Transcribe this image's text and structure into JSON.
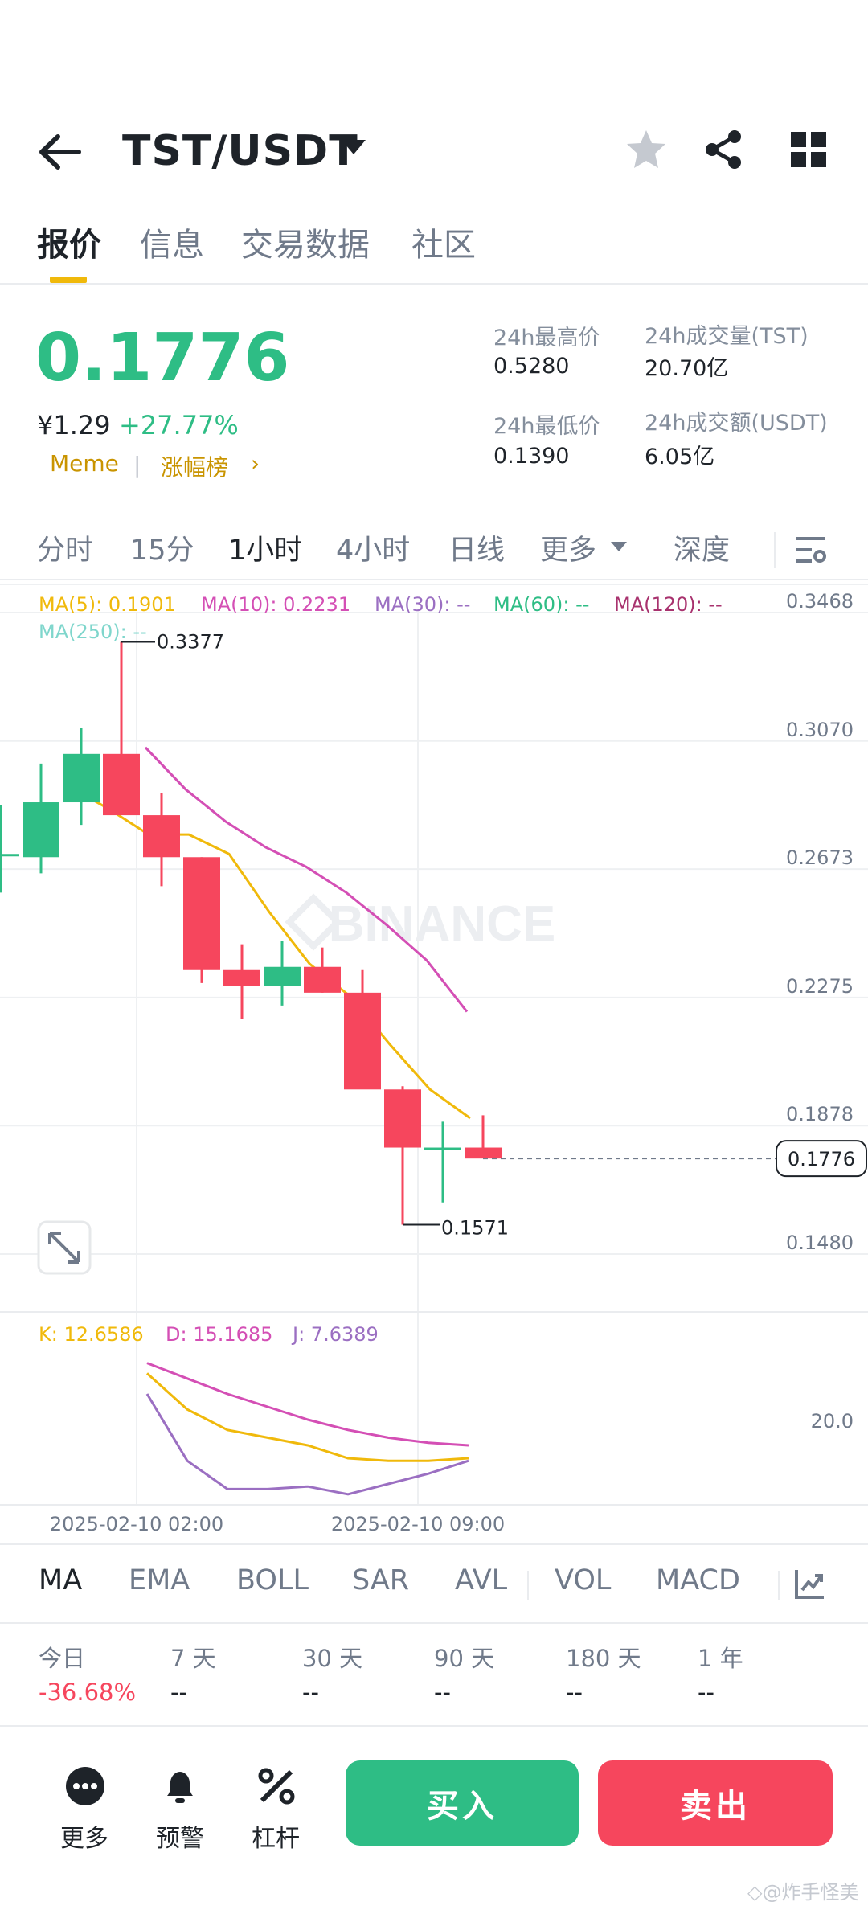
{
  "header": {
    "pair": "TST/USDT",
    "icons": [
      "back-arrow-icon",
      "caret-down-icon",
      "star-icon",
      "share-icon",
      "grid-icon"
    ]
  },
  "tabs": [
    {
      "label": "报价",
      "active": true
    },
    {
      "label": "信息",
      "active": false
    },
    {
      "label": "交易数据",
      "active": false
    },
    {
      "label": "社区",
      "active": false
    }
  ],
  "price": {
    "last": "0.1776",
    "cny": "¥1.29",
    "change": "+27.77%",
    "tag1": "Meme",
    "tag2": "涨幅榜",
    "tag2_arrow": "›",
    "colors": {
      "up": "#2ebd85",
      "down": "#f6465d",
      "accent": "#f0b90b"
    }
  },
  "stats": {
    "high_label": "24h最高价",
    "high": "0.5280",
    "vol_tst_label": "24h成交量(TST)",
    "vol_tst": "20.70亿",
    "low_label": "24h最低价",
    "low": "0.1390",
    "vol_usdt_label": "24h成交额(USDT)",
    "vol_usdt": "6.05亿"
  },
  "intervals": [
    {
      "label": "分时",
      "active": false
    },
    {
      "label": "15分",
      "active": false
    },
    {
      "label": "1小时",
      "active": true
    },
    {
      "label": "4小时",
      "active": false
    },
    {
      "label": "日线",
      "active": false
    },
    {
      "label": "更多",
      "active": false
    },
    {
      "label": "深度",
      "active": false
    }
  ],
  "chart_data": {
    "type": "candlestick",
    "watermark": "BINANCE",
    "ma_legend": [
      {
        "label": "MA(5): 0.1901",
        "color": "#f0b90b"
      },
      {
        "label": "MA(10): 0.2231",
        "color": "#d44fb5"
      },
      {
        "label": "MA(30): --",
        "color": "#9b6fc2"
      },
      {
        "label": "MA(60): --",
        "color": "#2ebd85"
      },
      {
        "label": "MA(120): --",
        "color": "#a8326e"
      },
      {
        "label": "MA(250): --",
        "color": "#7fd6cc"
      }
    ],
    "yticks": [
      "0.3468",
      "0.3070",
      "0.2673",
      "0.2275",
      "0.1878",
      "0.1480"
    ],
    "ylim": [
      0.148,
      0.3468
    ],
    "last_price_label": "0.1776",
    "high_marker": "0.3377",
    "low_marker": "0.1571",
    "candles": [
      {
        "o": 0.272,
        "h": 0.287,
        "l": 0.26,
        "c": 0.272
      },
      {
        "o": 0.271,
        "h": 0.3,
        "l": 0.266,
        "c": 0.288
      },
      {
        "o": 0.288,
        "h": 0.311,
        "l": 0.281,
        "c": 0.303
      },
      {
        "o": 0.303,
        "h": 0.3377,
        "l": 0.286,
        "c": 0.284
      },
      {
        "o": 0.284,
        "h": 0.291,
        "l": 0.262,
        "c": 0.271
      },
      {
        "o": 0.271,
        "h": 0.271,
        "l": 0.232,
        "c": 0.236
      },
      {
        "o": 0.236,
        "h": 0.244,
        "l": 0.221,
        "c": 0.231
      },
      {
        "o": 0.231,
        "h": 0.245,
        "l": 0.225,
        "c": 0.237
      },
      {
        "o": 0.237,
        "h": 0.243,
        "l": 0.229,
        "c": 0.229
      },
      {
        "o": 0.229,
        "h": 0.236,
        "l": 0.202,
        "c": 0.199
      },
      {
        "o": 0.199,
        "h": 0.2,
        "l": 0.1571,
        "c": 0.181
      },
      {
        "o": 0.181,
        "h": 0.189,
        "l": 0.164,
        "c": 0.181
      },
      {
        "o": 0.181,
        "h": 0.191,
        "l": 0.179,
        "c": 0.1776
      }
    ],
    "ma5": [
      0.293,
      0.286,
      0.278,
      0.278,
      0.272,
      0.254,
      0.238,
      0.228,
      0.213,
      0.199,
      0.1901
    ],
    "ma10": [
      0.305,
      0.292,
      0.282,
      0.274,
      0.268,
      0.26,
      0.25,
      0.239,
      0.2231
    ],
    "kdj_legend": [
      {
        "label": "K: 12.6586",
        "color": "#f0b90b"
      },
      {
        "label": "D: 15.1685",
        "color": "#d44fb5"
      },
      {
        "label": "J: 7.6389",
        "color": "#9b6fc2"
      }
    ],
    "kdj_ytick": "20.0",
    "kdj": {
      "K": [
        48,
        34,
        26,
        23,
        20,
        15,
        14,
        14,
        15
      ],
      "D": [
        52,
        46,
        40,
        35,
        30,
        26,
        23,
        21,
        20
      ],
      "J": [
        40,
        14,
        3,
        3,
        4,
        1,
        5,
        9,
        14
      ]
    },
    "x_labels": [
      "2025-02-10 02:00",
      "2025-02-10 09:00"
    ]
  },
  "indicators": [
    "MA",
    "EMA",
    "BOLL",
    "SAR",
    "AVL",
    "VOL",
    "MACD"
  ],
  "performance": [
    {
      "label": "今日",
      "value": "-36.68%"
    },
    {
      "label": "7 天",
      "value": "--"
    },
    {
      "label": "30 天",
      "value": "--"
    },
    {
      "label": "90 天",
      "value": "--"
    },
    {
      "label": "180 天",
      "value": "--"
    },
    {
      "label": "1 年",
      "value": "--"
    }
  ],
  "bottom": {
    "more": "更多",
    "alert": "预警",
    "leverage": "杠杆",
    "buy": "买入",
    "sell": "卖出"
  },
  "watermark_text": "◇@炸手怪美"
}
